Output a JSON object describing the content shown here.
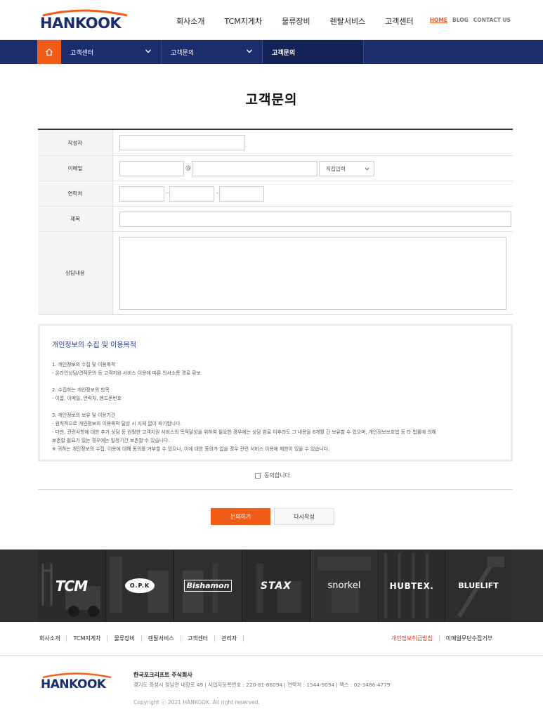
{
  "header": {
    "logo_text": "HANKOOK",
    "gnb": [
      "회사소개",
      "TCM지게차",
      "물류장비",
      "렌탈서비스",
      "고객센터"
    ],
    "top_links": [
      "HOME",
      "BLOG",
      "CONTACT US"
    ]
  },
  "subnav": {
    "depth1": "고객센터",
    "depth2": "고객문의",
    "depth3": "고객문의"
  },
  "page_title": "고객문의",
  "form": {
    "author_label": "작성자",
    "email_label": "이메일",
    "email_at": "@",
    "email_select": "직접입력",
    "phone_label": "연락처",
    "phone_sep": "-",
    "subject_label": "제목",
    "content_label": "상담내용"
  },
  "privacy": {
    "heading": "개인정보의 수집 및 이용목적",
    "lines": [
      "1. 개인정보의 수집 및 이용목적",
      "- 온라인상담/견적문의 등 고객지원 서비스 이용에 따른 의사소통 경로 확보",
      "",
      "2. 수집하는 개인정보의 항목",
      "- 이름, 이메일, 연락처, 핸드폰번호",
      "",
      "3. 개인정보의 보유 및 이용기간",
      "- 원칙적으로 개인정보의 이용목적 달성 시 지체 없이 파기합니다.",
      "- 다만, 관련사항에 대한 추가 상담 등 원활한 고객지원 서비스의 목적달성을 위하여 필요한 경우에는 상담 완료 이후라도 그 내용을 6개월 간 보유할 수 있으며, 개인정보보호법 등 타 법률에 의해",
      "보존할 필요가 있는 경우에는 일정기간 보존할 수 있습니다.",
      "※ 귀하는 개인정보의 수집, 이용에 대해 동의를 거부할 수 있으나, 이에 대한 동의가 없을 경우 관련 서비스 이용에 제한이 있을 수 있습니다."
    ]
  },
  "agree_label": "동의합니다.",
  "buttons": {
    "submit": "문의하기",
    "reset": "다시작성"
  },
  "brands": [
    "TCM",
    "O.P.K",
    "Bishamon",
    "STAX",
    "snorkel",
    "HUBTEX.",
    "BLUELIFT"
  ],
  "footer": {
    "menu": [
      "회사소개",
      "TCM지게차",
      "물류장비",
      "렌탈서비스",
      "고객센터",
      "관리자"
    ],
    "privacy_policy": "개인정보취급방침",
    "no_email": "이메일무단수집거부",
    "logo_text": "HANKOOK",
    "company": "한국포크리프트 주식회사",
    "address": "경기도 화성시 정남면 내향로 49   |   사업자등록번호 : 220-81-66094   |   연락처 : 1544-9094   |   팩스 : 02-3486-4779",
    "copyright": "Copyright ⓒ 2021 HANKOOK. All right reserved."
  },
  "colors": {
    "navy": "#1c2d6e",
    "orange": "#f25c19",
    "privacy_heading": "#21378a",
    "footer_red": "#e8341c"
  }
}
